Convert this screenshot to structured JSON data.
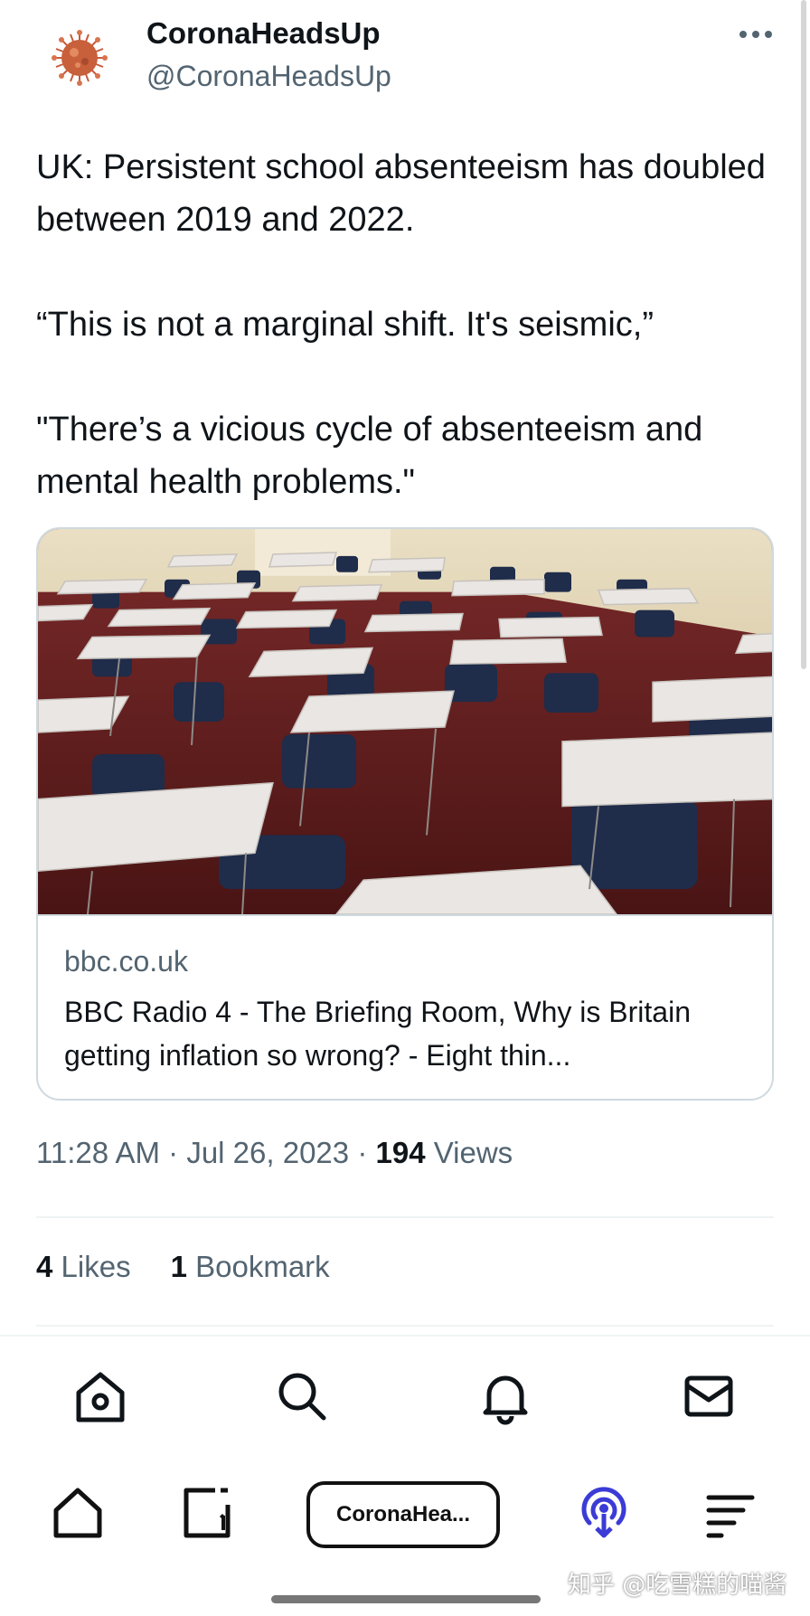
{
  "tweet": {
    "display_name": "CoronaHeadsUp",
    "handle": "@CoronaHeadsUp",
    "text": "UK: Persistent school absenteeism has doubled between 2019 and 2022.\n\n“This is not a marginal shift. It's seismic,”\n\n\"There’s a vicious cycle of absenteeism and mental health problems.\"",
    "time": "11:28 AM",
    "date": "Jul 26, 2023",
    "sep": "·",
    "views_count": "194",
    "views_label": "Views"
  },
  "card": {
    "domain": "bbc.co.uk",
    "title": "BBC Radio 4 - The Briefing Room, Why is Britain getting inflation so wrong? - Eight thin..."
  },
  "stats": {
    "likes_count": "4",
    "likes_label": "Likes",
    "bookmarks_count": "1",
    "bookmarks_label": "Bookmark"
  },
  "browser": {
    "tab_label": "CoronaHea..."
  },
  "watermark": "知乎 @吃雪糕的喵酱",
  "icons": {
    "more": "more-horizontal-icon",
    "home": "home-icon",
    "search": "search-icon",
    "notifications": "bell-icon",
    "messages": "mail-icon",
    "browser_home": "browser-home-icon",
    "tabs": "tabs-icon",
    "podcast": "podcast-icon",
    "menu": "menu-icon"
  },
  "colors": {
    "text_primary": "#0f1419",
    "text_secondary": "#536471",
    "border": "#cfd9de",
    "podcast_accent": "#3b3bd6"
  }
}
